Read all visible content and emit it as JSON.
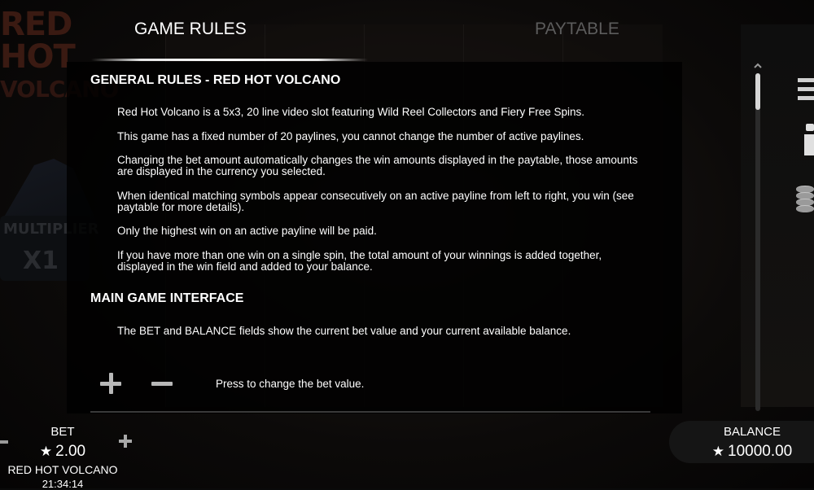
{
  "background": {
    "logo_line1": "RED HOT",
    "logo_line2": "VOLCANO",
    "multiplier_label": "MULTIPLIER",
    "multiplier_value": "X1"
  },
  "tabs": {
    "rules_label": "GAME RULES",
    "paytable_label": "PAYTABLE",
    "active": "GAME RULES"
  },
  "rules": {
    "general_heading": "GENERAL RULES - RED HOT VOLCANO",
    "paragraphs": [
      "Red Hot Volcano is a 5x3, 20 line video slot featuring Wild Reel Collectors and Fiery Free Spins.",
      "This game has a fixed number of 20 paylines, you cannot change the number of active paylines.",
      "Changing the bet amount automatically changes the win amounts displayed in the paytable, those amounts are displayed in the currency you selected.",
      "When identical matching symbols appear consecutively on an active payline from left to right, you win (see paytable for more details).",
      "Only the highest win on an active payline will be paid.",
      "If you have more than one win on a single spin, the total amount of your winnings is added together, displayed in the win field and added to your balance."
    ],
    "main_interface_heading": "MAIN GAME INTERFACE",
    "interface_text": "The BET and BALANCE fields show the current bet value and your current available balance.",
    "bet_buttons_text": "Press to change the bet value."
  },
  "bottom_bar": {
    "bet_label": "BET",
    "bet_value": "2.00",
    "game_name": "RED HOT VOLCANO",
    "clock": "21:34:14",
    "balance_label": "BALANCE",
    "balance_value": "10000.00",
    "currency_icon": "star-icon"
  },
  "colors": {
    "active_tab": "#ffffff",
    "inactive_tab": "#5c5c5c",
    "panel_bg": "#000000"
  }
}
